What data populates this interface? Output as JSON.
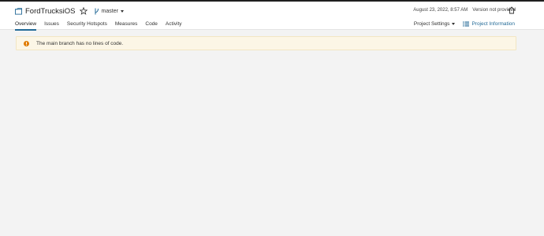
{
  "project": {
    "name": "FordTrucksiOS",
    "branch": "master"
  },
  "meta": {
    "date": "August 23, 2022, 8:57 AM",
    "version": "Version not provided"
  },
  "tabs": [
    "Overview",
    "Issues",
    "Security Hotspots",
    "Measures",
    "Code",
    "Activity"
  ],
  "actions": {
    "settings": "Project Settings",
    "info": "Project Information"
  },
  "alert": {
    "text": "The main branch has no lines of code."
  },
  "colors": {
    "accent": "#236a97",
    "alert_bg": "#fcf6e6",
    "alert_icon": "#e07b00",
    "page_bg": "#f3f3f3"
  },
  "icons": {
    "project": "folder-icon",
    "star": "star-icon",
    "branch": "branch-icon",
    "home": "home-icon",
    "info": "list-icon",
    "alert": "warning-icon"
  }
}
